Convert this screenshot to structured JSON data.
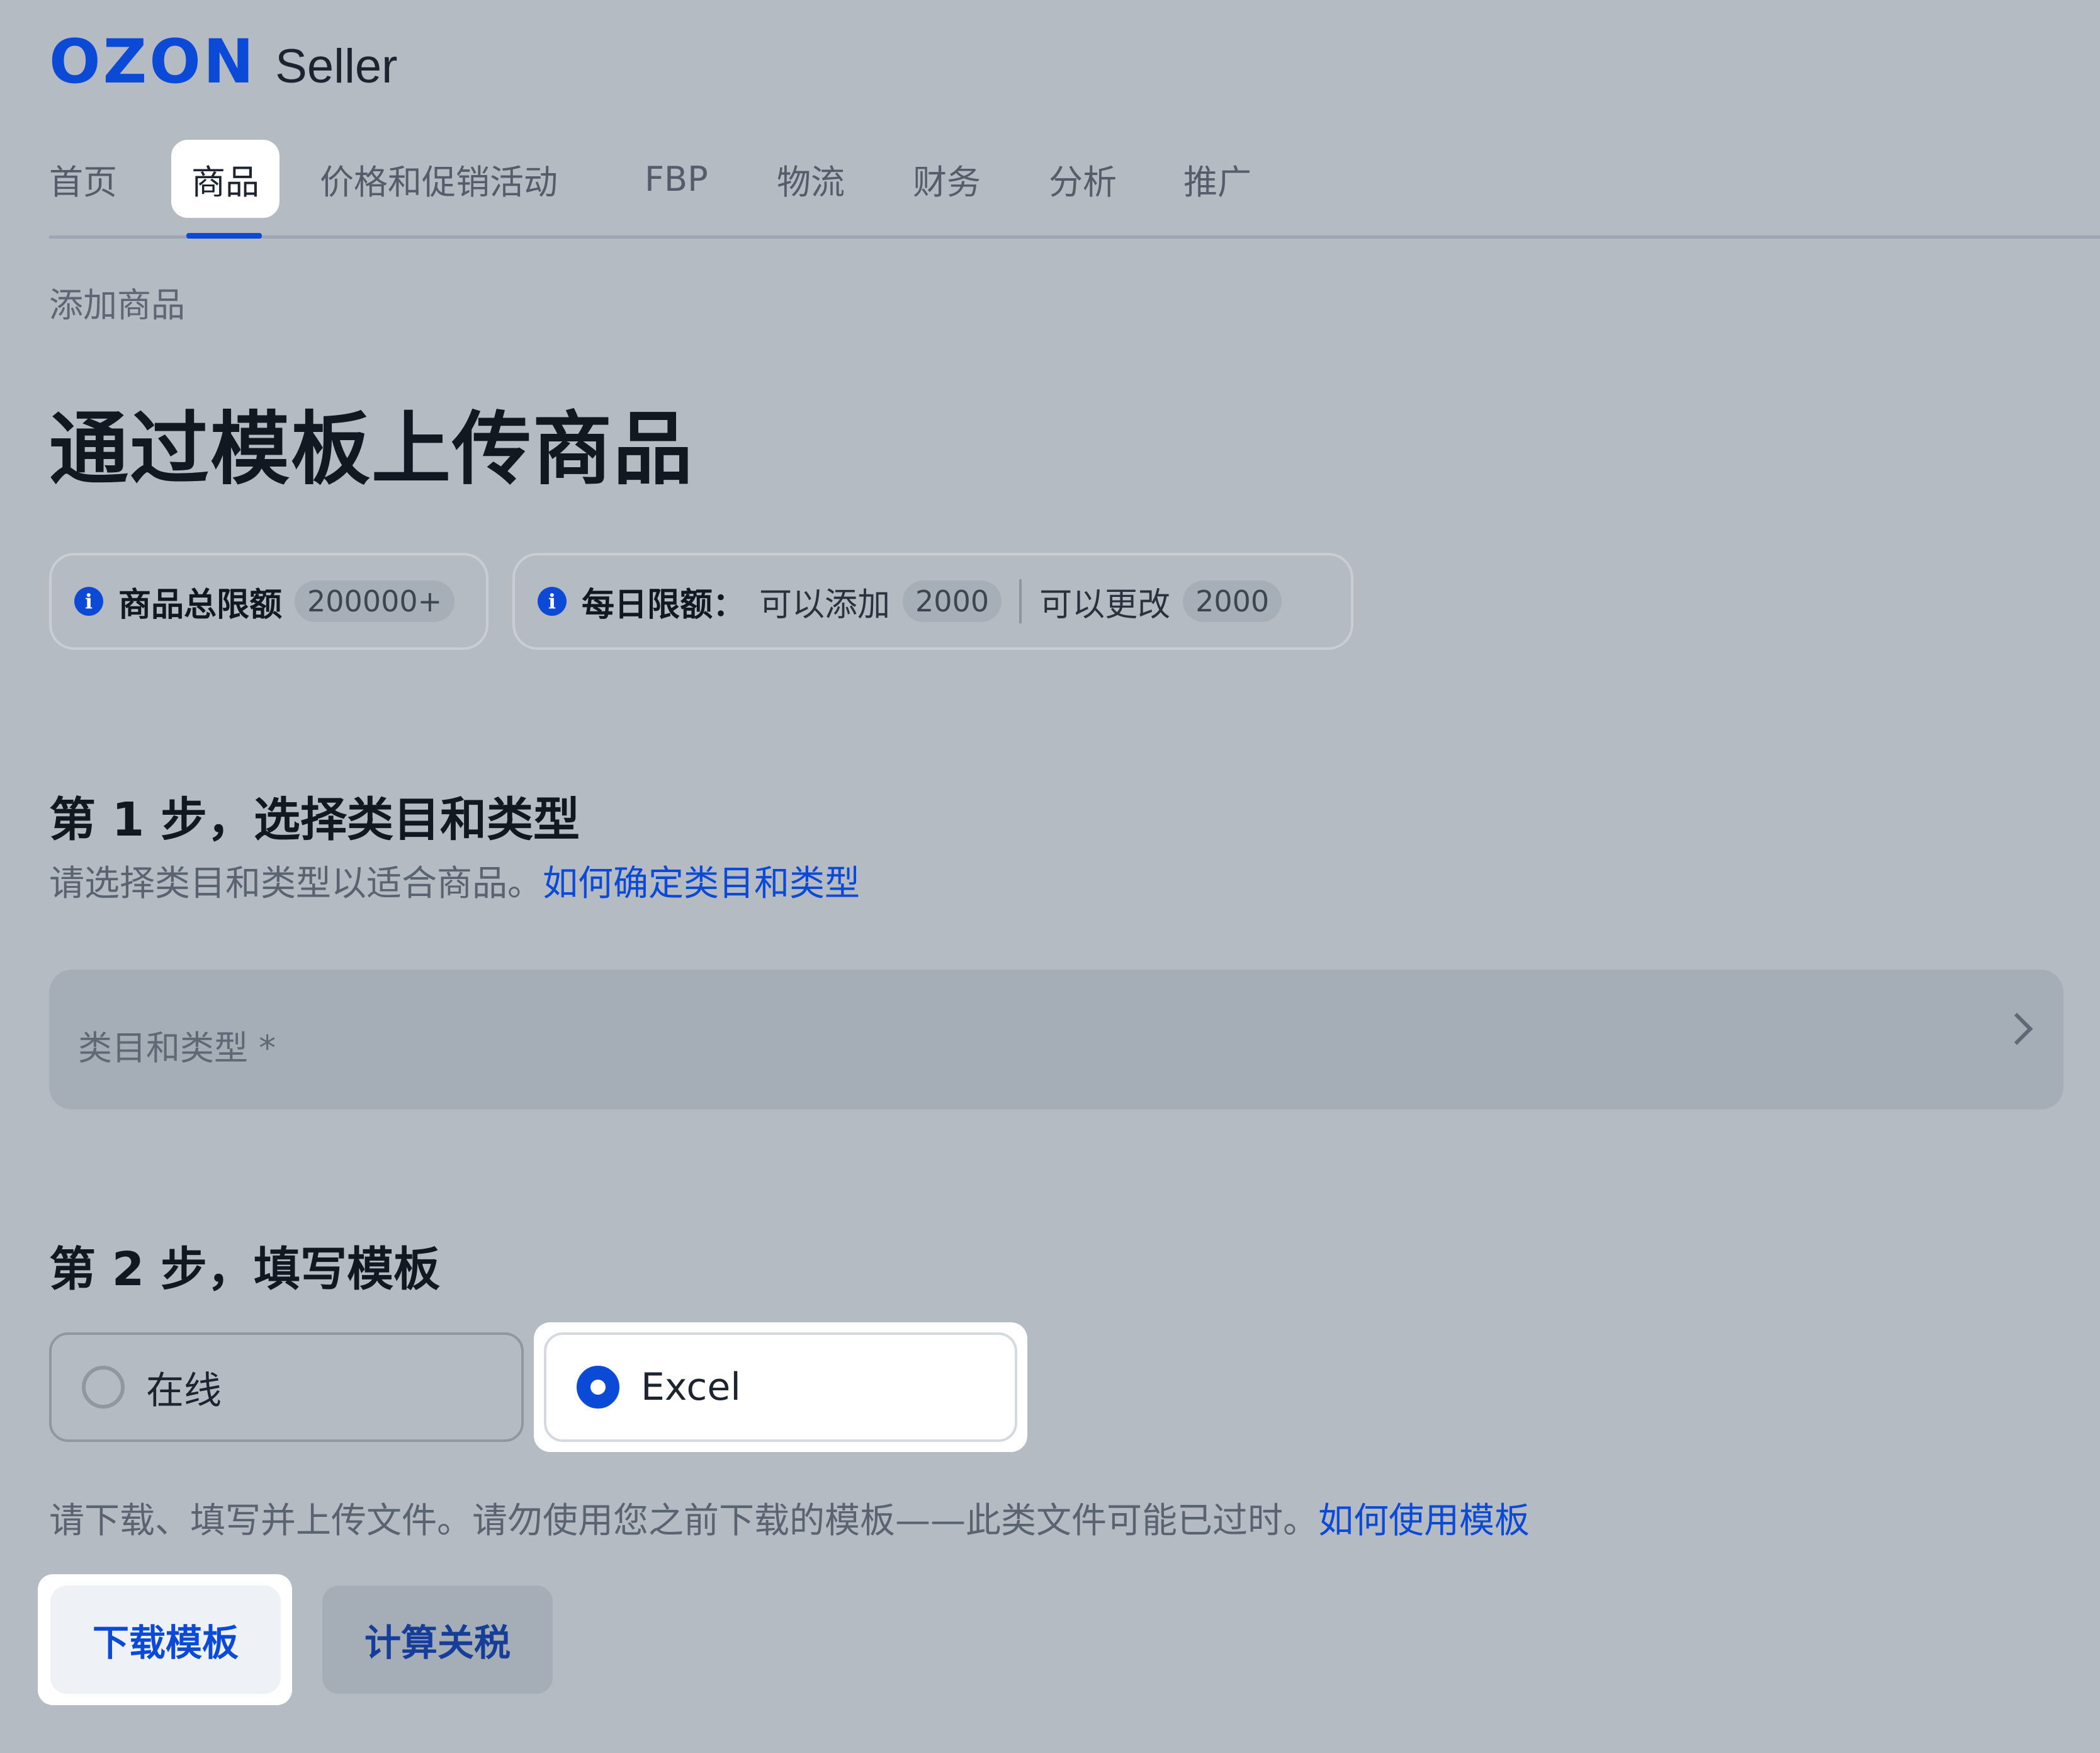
{
  "logo": {
    "brand": "OZON",
    "product": "Seller"
  },
  "nav": {
    "tabs": [
      {
        "label": "首页"
      },
      {
        "label": "商品",
        "active": true
      },
      {
        "label": "价格和促销活动"
      },
      {
        "label": "FBP"
      },
      {
        "label": "物流"
      },
      {
        "label": "财务"
      },
      {
        "label": "分析"
      },
      {
        "label": "推广"
      }
    ]
  },
  "breadcrumb": "添加商品",
  "page_title": "通过模板上传商品",
  "limits": {
    "total": {
      "label": "商品总限额",
      "value": "200000+"
    },
    "daily": {
      "label": "每日限额：",
      "add_label": "可以添加",
      "add_value": "2000",
      "edit_label": "可以更改",
      "edit_value": "2000"
    }
  },
  "step1": {
    "title": "第 1 步，选择类目和类型",
    "description": "请选择类目和类型以适合商品。",
    "help_link": "如何确定类目和类型",
    "field_placeholder": "类目和类型 *"
  },
  "step2": {
    "title": "第 2 步，填写模板",
    "options": [
      {
        "label": "在线",
        "selected": false
      },
      {
        "label": "Excel",
        "selected": true
      }
    ],
    "description": "请下载、填写并上传文件。请勿使用您之前下载的模板——此类文件可能已过时。",
    "help_link": "如何使用模板",
    "download_button": "下载模板",
    "tariff_button": "计算关税"
  },
  "colors": {
    "accent": "#0a4ad6",
    "background": "#b4bbc3"
  },
  "icons": [
    "info-icon",
    "chevron-right-icon",
    "radio-icon"
  ]
}
